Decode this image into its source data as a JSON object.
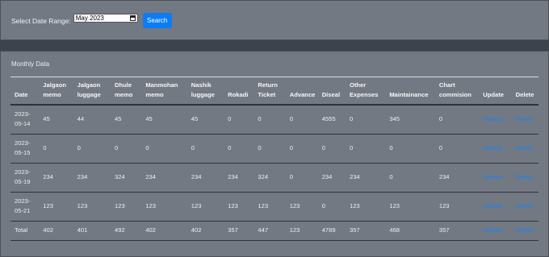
{
  "filter": {
    "label": "Select Date Range:",
    "date_value": "May 2023",
    "search_label": "Search"
  },
  "section": {
    "title": "Monthly Data"
  },
  "table": {
    "headers": [
      "Date",
      "Jalgaon memo",
      "Jalgaon luggage",
      "Dhule memo",
      "Manmohan memo",
      "Nashik luggage",
      "Rokadi",
      "Return Ticket",
      "Advance",
      "Diseal",
      "Other Expenses",
      "Maintainance",
      "Chart commision",
      "Update",
      "Delete"
    ],
    "rows": [
      {
        "date": "2023-05-14",
        "values": [
          "45",
          "44",
          "45",
          "45",
          "45",
          "0",
          "0",
          "0",
          "4555",
          "0",
          "345",
          "0"
        ],
        "update": "Update",
        "delete": "Delete"
      },
      {
        "date": "2023-05-15",
        "values": [
          "0",
          "0",
          "0",
          "0",
          "0",
          "0",
          "0",
          "0",
          "0",
          "0",
          "0",
          "0"
        ],
        "update": "Update",
        "delete": "Delete"
      },
      {
        "date": "2023-05-19",
        "values": [
          "234",
          "234",
          "324",
          "234",
          "234",
          "234",
          "324",
          "0",
          "234",
          "234",
          "0",
          "234"
        ],
        "update": "Update",
        "delete": "Delete"
      },
      {
        "date": "2023-05-21",
        "values": [
          "123",
          "123",
          "123",
          "123",
          "123",
          "123",
          "123",
          "123",
          "0",
          "123",
          "123",
          "123"
        ],
        "update": "Update",
        "delete": "Delete"
      },
      {
        "date": "Total",
        "values": [
          "402",
          "401",
          "492",
          "402",
          "402",
          "357",
          "447",
          "123",
          "4789",
          "357",
          "468",
          "357"
        ],
        "update": "Update",
        "delete": "Delete"
      }
    ]
  },
  "colors": {
    "accent": "#0a7cf5",
    "link": "#1a84f0",
    "panel": "#727983",
    "background": "#3d434b"
  },
  "icons": {
    "date_picker": "calendar-icon"
  }
}
